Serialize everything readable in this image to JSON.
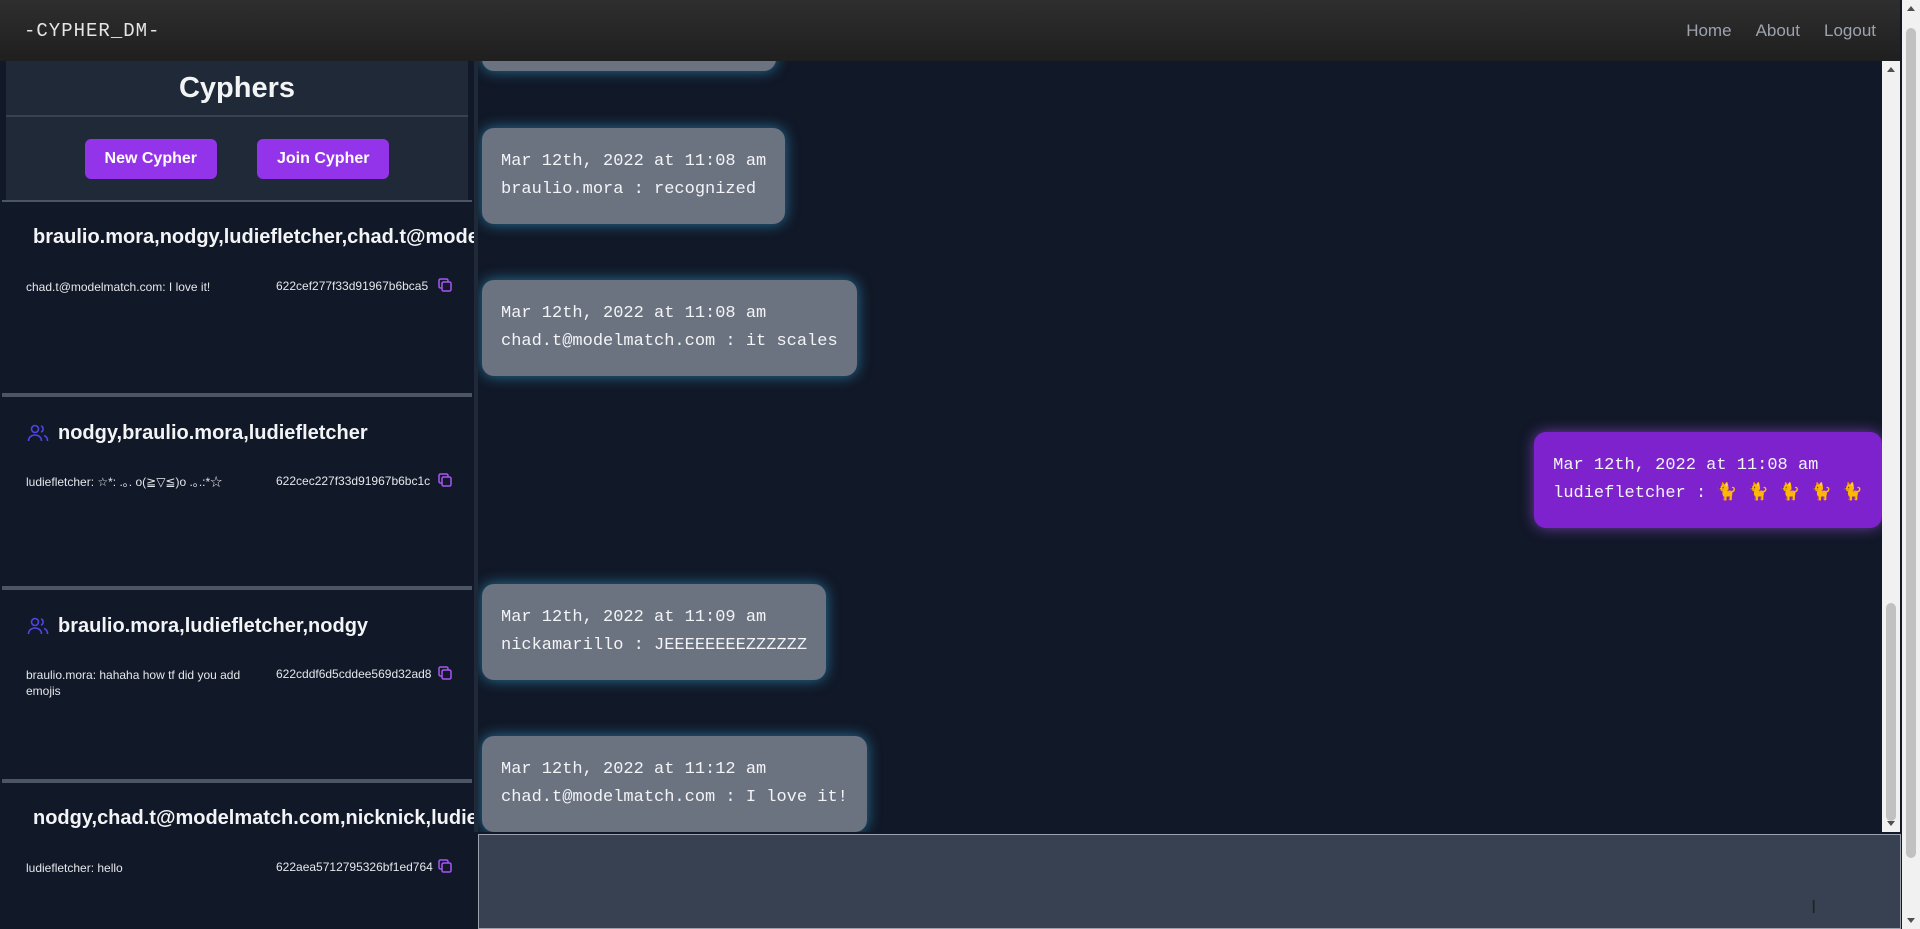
{
  "navbar": {
    "brand": "-CYPHER_DM-",
    "links": [
      "Home",
      "About",
      "Logout"
    ]
  },
  "sidebar": {
    "title": "Cyphers",
    "new_button": "New Cypher",
    "join_button": "Join Cypher",
    "cyphers": [
      {
        "title": "braulio.mora,nodgy,ludiefletcher,chad.t@modelmatch.com",
        "preview": "chad.t@modelmatch.com: I love it!",
        "id": "622cef277f33d91967b6bca5",
        "icon": "none"
      },
      {
        "title": "nodgy,braulio.mora,ludiefletcher",
        "preview": "ludiefletcher: ☆*: .｡. o(≧▽≦)o .｡.:*☆",
        "id": "622cec227f33d91967b6bc1c",
        "icon": "group-icon"
      },
      {
        "title": "braulio.mora,ludiefletcher,nodgy",
        "preview": "braulio.mora: hahaha how tf did you add emojis",
        "id": "622cddf6d5cddee569d32ad8",
        "icon": "group-icon"
      },
      {
        "title": "nodgy,chad.t@modelmatch.com,nicknick,ludiefletcher",
        "preview": "ludiefletcher: hello",
        "id": "622aea5712795326bf1ed764",
        "icon": "none"
      }
    ]
  },
  "chat": {
    "messages": [
      {
        "time": "Mar 12th, 2022 at 11:08 am",
        "text": "braulio.mora : recognized",
        "mine": false
      },
      {
        "time": "Mar 12th, 2022 at 11:08 am",
        "text": "chad.t@modelmatch.com : it scales",
        "mine": false
      },
      {
        "time": "Mar 12th, 2022 at 11:08 am",
        "text": "ludiefletcher : 🐈 🐈 🐈 🐈 🐈",
        "mine": true
      },
      {
        "time": "Mar 12th, 2022 at 11:09 am",
        "text": "nickamarillo : JEEEEEEEEZZZZZZ",
        "mine": false
      },
      {
        "time": "Mar 12th, 2022 at 11:12 am",
        "text": "chad.t@modelmatch.com : I love it!",
        "mine": false
      }
    ]
  },
  "composer": {
    "value": ""
  },
  "colors": {
    "accent": "#9333ea",
    "own_message": "#7e22ce",
    "other_message": "#6b7280",
    "background": "#111827",
    "glow": "#38bdf8"
  }
}
